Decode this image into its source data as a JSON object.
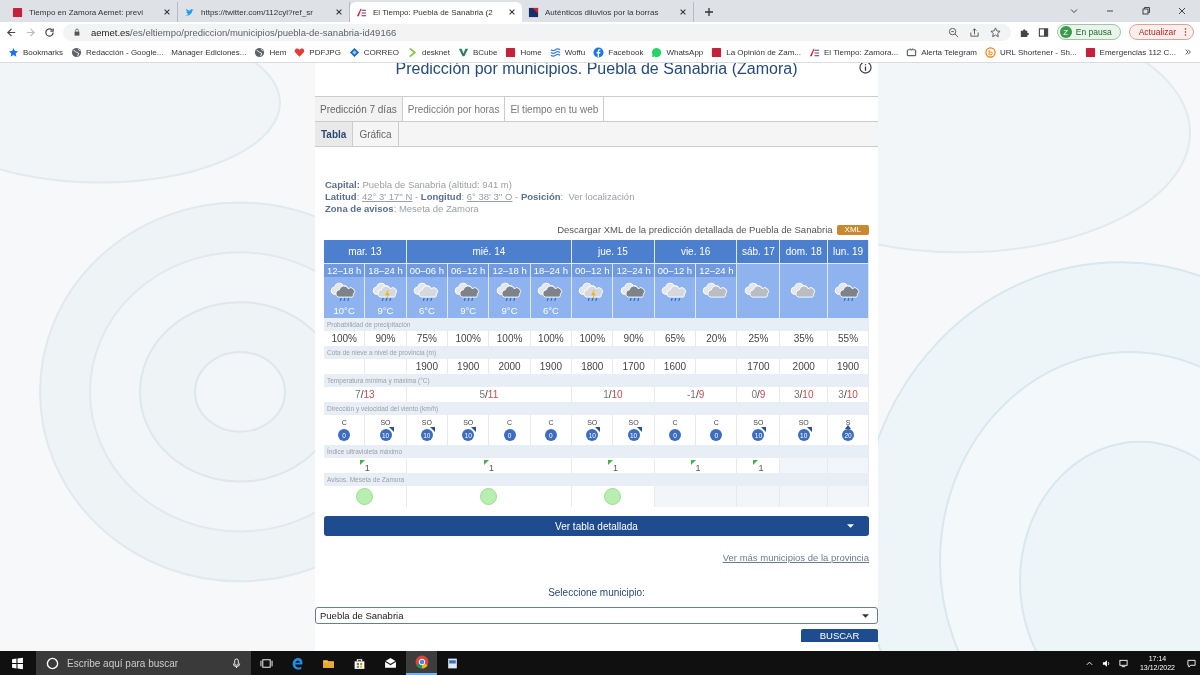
{
  "browser": {
    "tabs": [
      {
        "title": "Tiempo en Zamora Aemet: previ",
        "kind": "oz",
        "selected": false
      },
      {
        "title": "https://twitter.com/112cyl?ref_sr",
        "kind": "bird",
        "selected": false
      },
      {
        "title": "El Tiempo: Puebla de Sanabria (2",
        "kind": "ae",
        "selected": true
      },
      {
        "title": "Auténticos diluvios por la borras",
        "kind": "square",
        "selected": false
      }
    ],
    "address": {
      "host": "aemet.es",
      "path": "/es/eltiempo/prediccion/municipios/puebla-de-sanabria-id49166"
    },
    "profile": {
      "initial": "Z",
      "label": "En pausa"
    },
    "update_button": "Actualizar",
    "bookmarks": [
      {
        "label": "Bookmarks",
        "kind": "star"
      },
      {
        "label": "Redacción - Google...",
        "kind": "globe"
      },
      {
        "label": "Mánager Ediciones...",
        "kind": "none"
      },
      {
        "label": "Hem",
        "kind": "globe"
      },
      {
        "label": "PDFJPG",
        "kind": "heart"
      },
      {
        "label": "CORREO",
        "kind": "diamond"
      },
      {
        "label": "desknet",
        "kind": "chevron"
      },
      {
        "label": "BCube",
        "kind": "vee"
      },
      {
        "label": "Home",
        "kind": "oz"
      },
      {
        "label": "Woffu",
        "kind": "waves"
      },
      {
        "label": "Facebook",
        "kind": "fb"
      },
      {
        "label": "WhatsApp",
        "kind": "wa"
      },
      {
        "label": "La Opinión de Zam...",
        "kind": "oz"
      },
      {
        "label": "El Tiempo: Zamora...",
        "kind": "ae"
      },
      {
        "label": "Alerta Telegram",
        "kind": "tv"
      },
      {
        "label": "URL Shortener - Sh...",
        "kind": "b"
      },
      {
        "label": "Emergencias 112 C...",
        "kind": "red"
      }
    ]
  },
  "page": {
    "title": "Predicción por municipios. Puebla de Sanabria (Zamora)",
    "tabs": [
      {
        "label": "Predicción 7 días",
        "selected": true
      },
      {
        "label": "Predicción por horas",
        "selected": false
      },
      {
        "label": "El tiempo en tu web",
        "selected": false
      }
    ],
    "subtabs": [
      {
        "label": "Tabla",
        "selected": true
      },
      {
        "label": "Gráfica",
        "selected": false
      }
    ],
    "info": {
      "capital": "**Capital:** Puebla de Sanabria (altitud: 941 m)",
      "coordinates": [
        {
          "kind": "label",
          "text": "Latitud"
        },
        {
          "kind": "text",
          "text": ": "
        },
        {
          "kind": "coord",
          "text": "42° 3' 17'' N"
        },
        {
          "kind": "text",
          "text": " - "
        },
        {
          "kind": "label",
          "text": "Longitud"
        },
        {
          "kind": "text",
          "text": ": "
        },
        {
          "kind": "coord",
          "text": "6° 38' 3'' O"
        },
        {
          "kind": "text",
          "text": " - "
        },
        {
          "kind": "label",
          "text": "Posición"
        },
        {
          "kind": "text",
          "text": ":  "
        },
        {
          "kind": "link",
          "text": "Ver localización"
        }
      ],
      "zone": "**Zona de avisos**: Meseta de Zamora"
    },
    "xml": {
      "text": "Descargar XML de la predicción detallada de Puebla de Sanabria",
      "badge": "XML"
    },
    "forecast": {
      "labels": {
        "precipitation": "Probabilidad de precipitación",
        "snow": "Cota de nieve a nivel de provincia (m)",
        "temperature": "Temperatura mínima y máxima (°C)",
        "wind": "Dirección y velocidad del viento (km/h)",
        "uv": "Índice ultravioleta máximo",
        "warnings": "Avisos. Meseta de Zamora"
      },
      "days": [
        {
          "label": "mar. 13",
          "periods": [
            {
              "time": "12–18 h",
              "kind": "rain",
              "temp": "10°C",
              "precipitation": "100%",
              "wind": {
                "dir": "C",
                "speed": "0",
                "kind": "calm"
              }
            },
            {
              "time": "18–24 h",
              "kind": "storm",
              "temp": "9°C",
              "precipitation": "90%",
              "wind": {
                "dir": "SO",
                "speed": "10",
                "kind": "ne"
              }
            }
          ],
          "temperature": {
            "min": "7",
            "separator": "/",
            "max": "13"
          },
          "uv": "1",
          "warning": true
        },
        {
          "label": "mié. 14",
          "periods": [
            {
              "time": "00–06 h",
              "kind": "showers",
              "temp": "6°C",
              "precipitation": "75%",
              "snow": "1900",
              "wind": {
                "dir": "SO",
                "speed": "10",
                "kind": "ne"
              }
            },
            {
              "time": "06–12 h",
              "kind": "rain",
              "temp": "9°C",
              "precipitation": "100%",
              "snow": "1900",
              "wind": {
                "dir": "SO",
                "speed": "10",
                "kind": "ne"
              }
            },
            {
              "time": "12–18 h",
              "kind": "rain",
              "temp": "9°C",
              "precipitation": "100%",
              "snow": "2000",
              "wind": {
                "dir": "C",
                "speed": "0",
                "kind": "calm"
              }
            },
            {
              "time": "18–24 h",
              "kind": "rain",
              "temp": "6°C",
              "precipitation": "100%",
              "snow": "1900",
              "wind": {
                "dir": "C",
                "speed": "0",
                "kind": "calm"
              }
            }
          ],
          "temperature": {
            "min": "5",
            "separator": "/",
            "max": "11"
          },
          "uv": "1",
          "warning": true
        },
        {
          "label": "jue. 15",
          "periods": [
            {
              "time": "00–12 h",
              "kind": "storm",
              "precipitation": "100%",
              "snow": "1800",
              "wind": {
                "dir": "SO",
                "speed": "10",
                "kind": "ne"
              }
            },
            {
              "time": "12–24 h",
              "kind": "rain",
              "precipitation": "90%",
              "snow": "1700",
              "wind": {
                "dir": "SO",
                "speed": "10",
                "kind": "ne"
              }
            }
          ],
          "temperature": {
            "min": "1",
            "separator": "/",
            "max": "10"
          },
          "uv": "1",
          "warning": true
        },
        {
          "label": "vie. 16",
          "periods": [
            {
              "time": "00–12 h",
              "kind": "sun-showers",
              "precipitation": "65%",
              "snow": "1600",
              "wind": {
                "dir": "C",
                "speed": "0",
                "kind": "calm"
              }
            },
            {
              "time": "12–24 h",
              "kind": "cloudy",
              "precipitation": "20%",
              "wind": {
                "dir": "C",
                "speed": "0",
                "kind": "calm"
              }
            }
          ],
          "temperature": {
            "min": "-1",
            "separator": "/",
            "max": "9"
          },
          "uv": "1",
          "warning": false
        },
        {
          "label": "sáb. 17",
          "periods": [
            {
              "kind": "cloudy",
              "precipitation": "25%",
              "snow": "1700",
              "wind": {
                "dir": "SO",
                "speed": "10",
                "kind": "ne"
              }
            }
          ],
          "temperature": {
            "min": "0",
            "separator": "/",
            "max": "9"
          },
          "uv": "1",
          "warning": false
        },
        {
          "label": "dom. 18",
          "periods": [
            {
              "kind": "cloudy",
              "precipitation": "35%",
              "snow": "2000",
              "wind": {
                "dir": "SO",
                "speed": "10",
                "kind": "ne"
              }
            }
          ],
          "temperature": {
            "min": "3",
            "separator": "/",
            "max": "10"
          },
          "warning": false
        },
        {
          "label": "lun. 19",
          "periods": [
            {
              "kind": "rain",
              "precipitation": "55%",
              "snow": "1900",
              "wind": {
                "dir": "S",
                "speed": "20",
                "kind": "n"
              }
            }
          ],
          "temperature": {
            "min": "3",
            "separator": "/",
            "max": "10"
          },
          "warning": false
        }
      ]
    },
    "detail_button": "Ver tabla detallada",
    "more_link": "Ver más municipios de la provincia",
    "select_label": "Seleccione municipio:",
    "select_value": "Puebla de Sanabria",
    "search_button": "BUSCAR"
  },
  "taskbar": {
    "search_placeholder": "Escribe aquí para buscar",
    "time": "17:14",
    "date": "13/12/2022"
  }
}
